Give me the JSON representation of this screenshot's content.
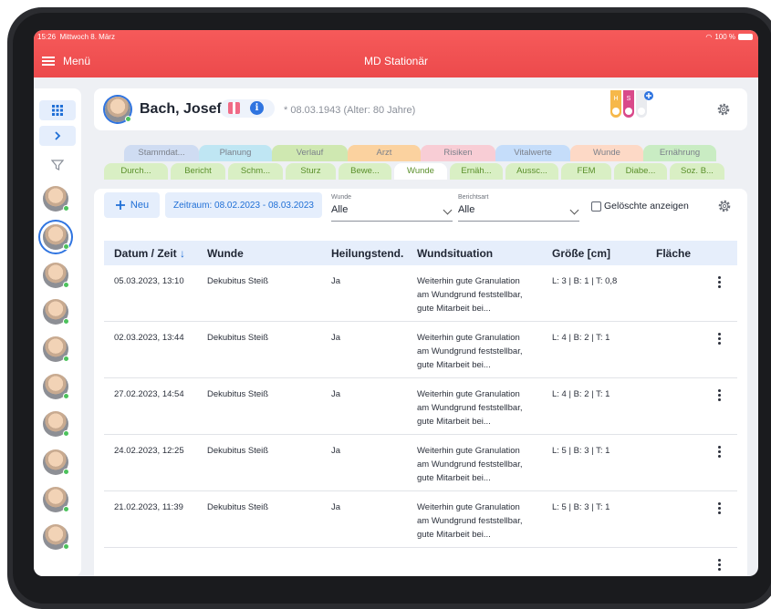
{
  "status_bar": {
    "time": "15:26",
    "date": "Mittwoch 8. März",
    "battery": "100 %"
  },
  "app_bar": {
    "menu_label": "Menü",
    "title": "MD Stationär"
  },
  "sidebar": {
    "grid_icon": "grid-icon",
    "expand_icon": "chevron-right-icon",
    "filter_icon": "filter-icon",
    "patient_count": 10
  },
  "patient": {
    "name": "Bach, Josef",
    "dob": "* 08.03.1943 (Alter: 80 Jahre)",
    "tube_h": "H",
    "tube_s": "S"
  },
  "tabs_top": [
    {
      "label": "Stammdat...",
      "color": "#cfdcf2"
    },
    {
      "label": "Planung",
      "color": "#bfe6f3"
    },
    {
      "label": "Verlauf",
      "color": "#cfe8b1"
    },
    {
      "label": "Arzt",
      "color": "#fbd29f"
    },
    {
      "label": "Risiken",
      "color": "#f8cdd5"
    },
    {
      "label": "Vitalwerte",
      "color": "#c5ddfa"
    },
    {
      "label": "Wunde",
      "color": "#fdd9c6"
    },
    {
      "label": "Ernährung",
      "color": "#c9ecc3"
    }
  ],
  "tabs_bottom": [
    {
      "label": "Durch...",
      "active": false
    },
    {
      "label": "Bericht",
      "active": false
    },
    {
      "label": "Schm...",
      "active": false
    },
    {
      "label": "Sturz",
      "active": false
    },
    {
      "label": "Bewe...",
      "active": false
    },
    {
      "label": "Wunde",
      "active": true
    },
    {
      "label": "Ernäh...",
      "active": false
    },
    {
      "label": "Aussc...",
      "active": false
    },
    {
      "label": "FEM",
      "active": false
    },
    {
      "label": "Diabe...",
      "active": false
    },
    {
      "label": "Soz. B...",
      "active": false
    }
  ],
  "toolbar": {
    "new_label": "Neu",
    "period_label": "Zeitraum: 08.02.2023 - 08.03.2023",
    "wound_label": "Wunde",
    "wound_value": "Alle",
    "report_label": "Berichtsart",
    "report_value": "Alle",
    "deleted_label": "Gelöschte anzeigen"
  },
  "table": {
    "headers": [
      "Datum / Zeit",
      "Wunde",
      "Heilungstend.",
      "Wundsituation",
      "Größe [cm]",
      "Fläche"
    ],
    "rows": [
      {
        "date": "05.03.2023, 13:10",
        "wound": "Dekubitus Steiß",
        "healing": "Ja",
        "situation": [
          "Weiterhin gute Granulation",
          "am Wundgrund feststellbar,",
          "gute Mitarbeit bei..."
        ],
        "size": "L: 3 | B: 1 | T: 0,8"
      },
      {
        "date": "02.03.2023, 13:44",
        "wound": "Dekubitus Steiß",
        "healing": "Ja",
        "situation": [
          "Weiterhin gute Granulation",
          "am Wundgrund feststellbar,",
          "gute Mitarbeit bei..."
        ],
        "size": "L: 4 | B: 2 | T: 1"
      },
      {
        "date": "27.02.2023, 14:54",
        "wound": "Dekubitus Steiß",
        "healing": "Ja",
        "situation": [
          "Weiterhin gute Granulation",
          "am Wundgrund feststellbar,",
          "gute Mitarbeit bei..."
        ],
        "size": "L: 4 | B: 2 | T: 1"
      },
      {
        "date": "24.02.2023, 12:25",
        "wound": "Dekubitus Steiß",
        "healing": "Ja",
        "situation": [
          "Weiterhin gute Granulation",
          "am Wundgrund feststellbar,",
          "gute Mitarbeit bei..."
        ],
        "size": "L: 5 | B: 3 | T: 1"
      },
      {
        "date": "21.02.2023, 11:39",
        "wound": "Dekubitus Steiß",
        "healing": "Ja",
        "situation": [
          "Weiterhin gute Granulation",
          "am Wundgrund feststellbar,",
          "gute Mitarbeit bei..."
        ],
        "size": "L: 5 | B: 3 | T: 1"
      }
    ]
  },
  "colors": {
    "app_bar": "#f05254",
    "accent_blue": "#2f74e0",
    "table_header": "#e6eefb"
  }
}
